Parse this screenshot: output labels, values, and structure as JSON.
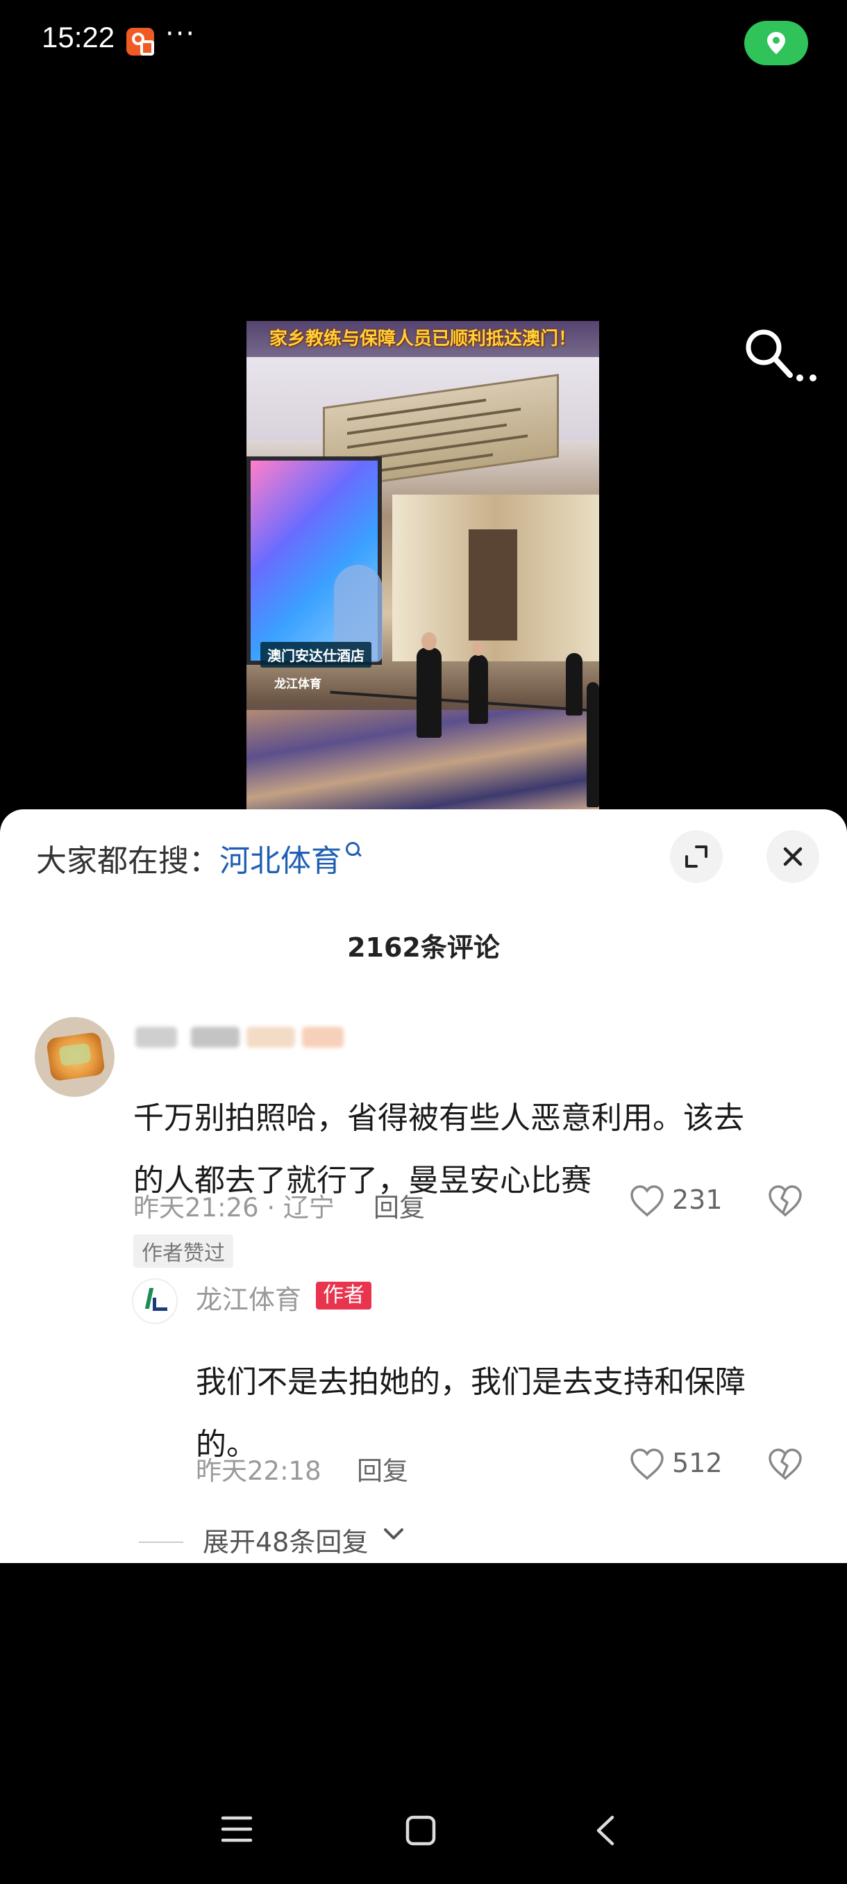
{
  "status_bar": {
    "time": "15:22",
    "more": "···",
    "app_icon": "kuaishou-app-icon",
    "location_icon": "location-pin-icon",
    "location_color": "#2fc35a"
  },
  "video": {
    "caption": "家乡教练与保障人员已顺利抵达澳门！",
    "location_label": "澳门安达仕酒店",
    "logo_text": "龙江体育",
    "search_icon": "search-icon"
  },
  "panel": {
    "hot_search_prefix": "大家都在搜：",
    "hot_search_term": "河北体育",
    "expand_icon": "fullscreen-icon",
    "close_icon": "close-icon",
    "comment_count": "2162条评论"
  },
  "comment": {
    "text_line1": "千万别拍照哈，省得被有些人恶意利用。该去",
    "text_line2": "的人都去了就行了，曼昱安心比赛",
    "time_location": "昨天21:26 · 辽宁",
    "reply_label": "回复",
    "like_count": "231",
    "author_liked": "作者赞过"
  },
  "reply": {
    "name": "龙江体育",
    "tag": "作者",
    "text_line1": "我们不是去拍她的，我们是去支持和保障",
    "text_line2": "的。",
    "time": "昨天22:18",
    "reply_label": "回复",
    "like_count": "512"
  },
  "expand_replies": "展开48条回复",
  "nav": {
    "menu_icon": "menu-icon",
    "home_icon": "home-icon",
    "back_icon": "back-icon"
  },
  "colors": {
    "accent_link": "#1f5fb3",
    "author_tag": "#e8344e",
    "caption_yellow": "#ffd23a"
  }
}
